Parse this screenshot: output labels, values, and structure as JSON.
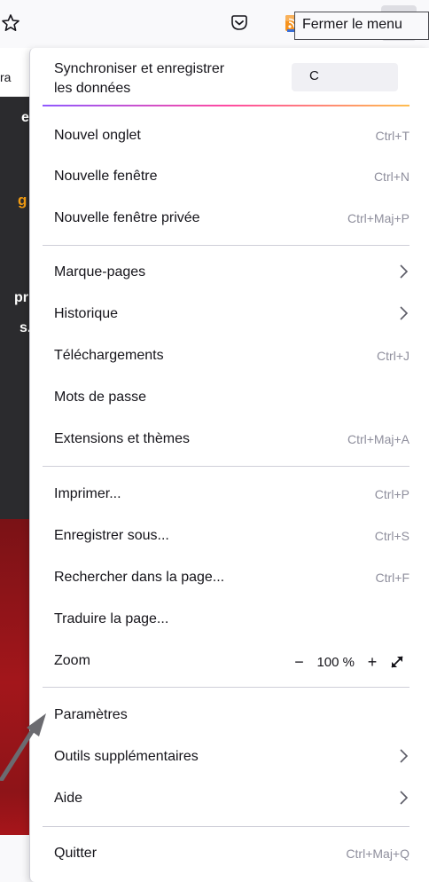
{
  "toolbar": {
    "icons": [
      "star-icon",
      "pocket-icon",
      "rss-icon",
      "extensions-icon",
      "hamburger-menu-icon"
    ]
  },
  "background": {
    "frag_ra": "ra",
    "frag_c": "e c",
    "frag_g": "g",
    "frag_pr": "pr",
    "frag_s": "s."
  },
  "sync": {
    "title_line1": "Synchroniser et enregistrer",
    "title_line2": "les données",
    "button_label": "C",
    "tooltip": "Fermer le menu"
  },
  "menu": {
    "new_tab": {
      "label": "Nouvel onglet",
      "shortcut": "Ctrl+T"
    },
    "new_window": {
      "label": "Nouvelle fenêtre",
      "shortcut": "Ctrl+N"
    },
    "new_private": {
      "label": "Nouvelle fenêtre privée",
      "shortcut": "Ctrl+Maj+P"
    },
    "bookmarks": {
      "label": "Marque-pages"
    },
    "history": {
      "label": "Historique"
    },
    "downloads": {
      "label": "Téléchargements",
      "shortcut": "Ctrl+J"
    },
    "passwords": {
      "label": "Mots de passe"
    },
    "addons": {
      "label": "Extensions et thèmes",
      "shortcut": "Ctrl+Maj+A"
    },
    "print": {
      "label": "Imprimer...",
      "shortcut": "Ctrl+P"
    },
    "save_as": {
      "label": "Enregistrer sous...",
      "shortcut": "Ctrl+S"
    },
    "find": {
      "label": "Rechercher dans la page...",
      "shortcut": "Ctrl+F"
    },
    "translate": {
      "label": "Traduire la page..."
    },
    "zoom": {
      "label": "Zoom",
      "minus": "−",
      "value": "100 %",
      "plus": "+"
    },
    "settings": {
      "label": "Paramètres"
    },
    "more_tools": {
      "label": "Outils supplémentaires"
    },
    "help": {
      "label": "Aide"
    },
    "quit": {
      "label": "Quitter",
      "shortcut": "Ctrl+Maj+Q"
    }
  },
  "colors": {
    "menu_bg": "#ffffff",
    "toolbar_bg": "#f9f9fb",
    "shortcut_text": "#8f8f9d",
    "separator": "#cfcfd8",
    "accent_orange": "#f39c12",
    "pointer_arrow": "#6b6b70"
  }
}
